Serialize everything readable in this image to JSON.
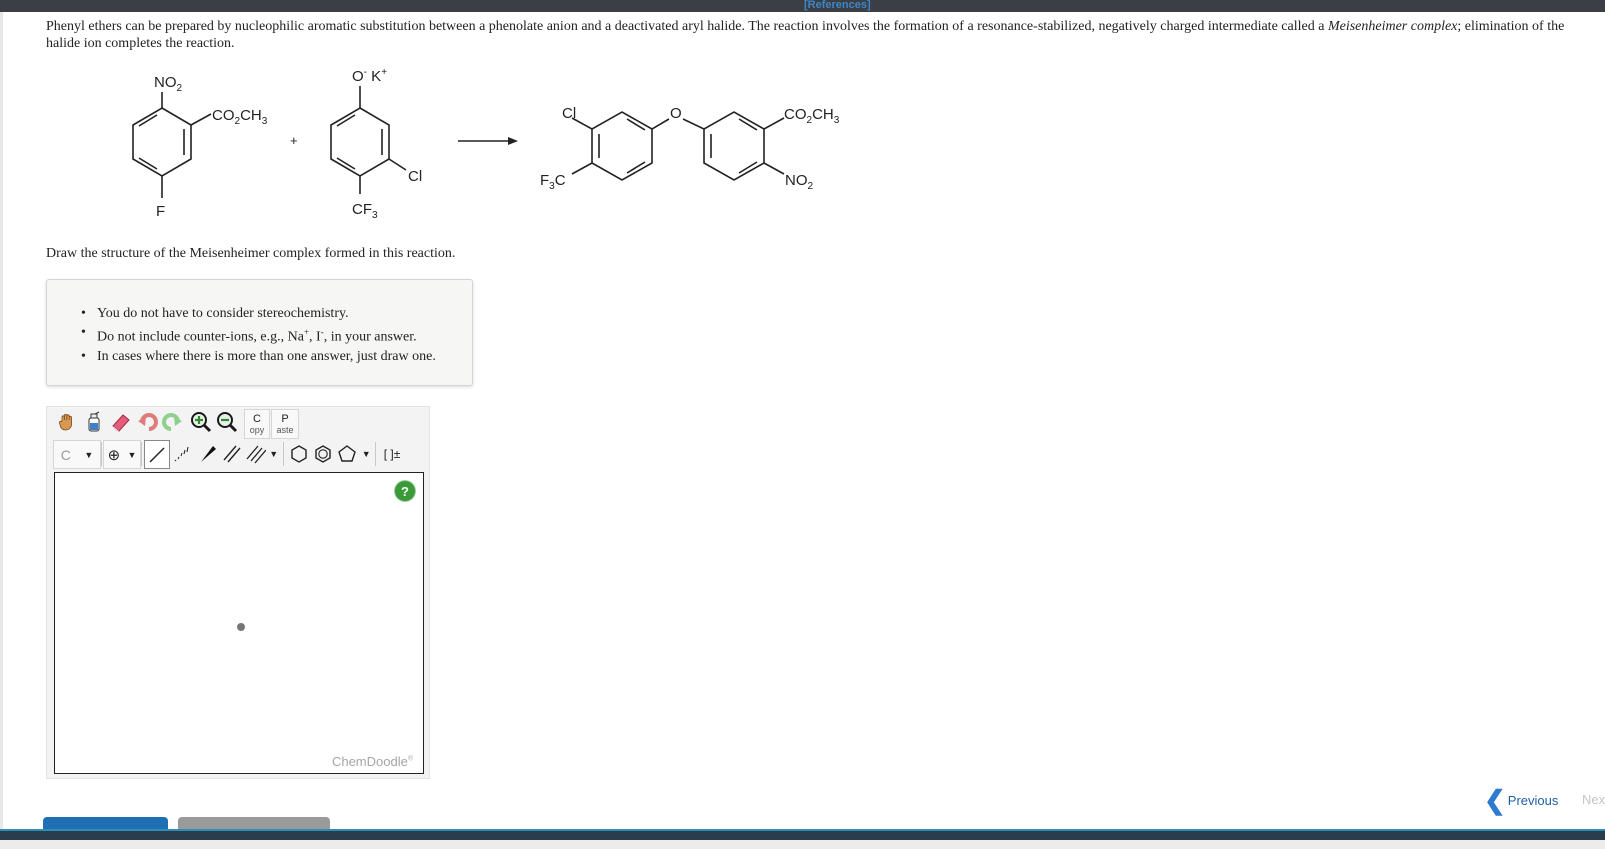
{
  "header": {
    "references_link": "[References]"
  },
  "intro": {
    "text_before": "Phenyl ethers can be prepared by nucleophilic aromatic substitution between a phenolate anion and a deactivated aryl halide. The reaction involves the formation of a resonance-stabilized, negatively charged intermediate called a ",
    "term": "Meisenheimer complex",
    "text_after": "; elimination of the halide ion completes the reaction."
  },
  "scheme": {
    "reactant1": {
      "top": "NO2",
      "right": "CO2CH3",
      "bottom": "F"
    },
    "plus": "+",
    "reactant2": {
      "top": "O- K+",
      "right": "Cl",
      "bottom": "CF3"
    },
    "product": {
      "left_top": "Cl",
      "left_bottom": "F3C",
      "bridge": "O",
      "right_top": "CO2CH3",
      "right_bottom": "NO2"
    }
  },
  "question": "Draw the structure of the Meisenheimer complex formed in this reaction.",
  "notes": {
    "item1": "You do not have to consider stereochemistry.",
    "item2_a": "Do not include counter-ions, e.g., Na",
    "item2_sup1": "+",
    "item2_b": ", I",
    "item2_sup2": "-",
    "item2_c": ", in your answer.",
    "item3": "In cases where there is more than one answer, just draw one."
  },
  "editor": {
    "copy_top": "C",
    "copy_bottom": "opy",
    "paste_top": "P",
    "paste_bottom": "aste",
    "element_label": "C",
    "charge_label": "⊕",
    "bracket_label": "[ ]±",
    "help_label": "?",
    "brand": "ChemDoodle",
    "brand_mark": "®"
  },
  "nav": {
    "previous": "Previous",
    "next": "Next"
  },
  "colors": {
    "accent": "#1e6fb3",
    "help": "#3a9a3a",
    "topbar": "#3b3f45"
  }
}
